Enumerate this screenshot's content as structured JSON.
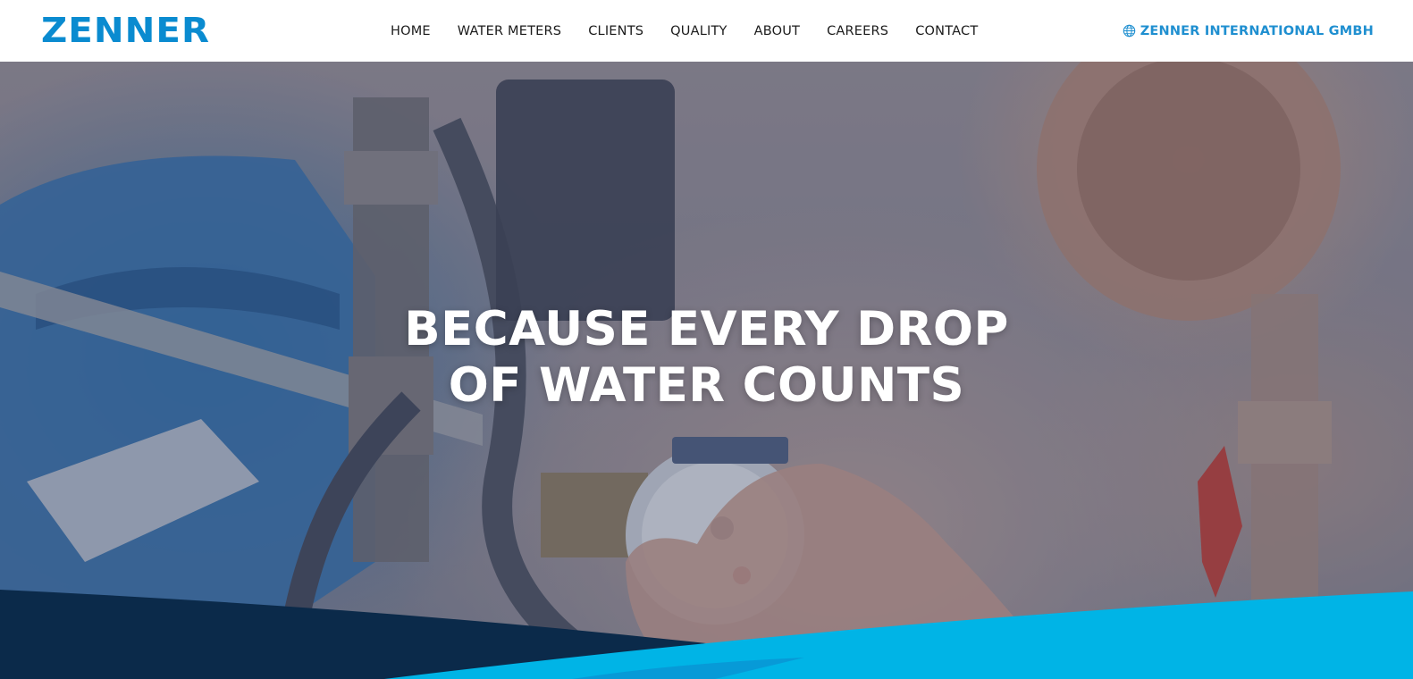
{
  "header": {
    "logo": "ZENNER",
    "nav": [
      {
        "label": "HOME"
      },
      {
        "label": "WATER METERS"
      },
      {
        "label": "CLIENTS"
      },
      {
        "label": "QUALITY"
      },
      {
        "label": "ABOUT"
      },
      {
        "label": "CAREERS"
      },
      {
        "label": "CONTACT"
      }
    ],
    "company_link": {
      "label": "ZENNER INTERNATIONAL GMBH",
      "icon": "globe-icon"
    }
  },
  "hero": {
    "title_line1": "BECAUSE EVERY DROP",
    "title_line2": "OF WATER COUNTS"
  },
  "colors": {
    "brand_blue": "#0a8bd0",
    "link_blue": "#1f8fd0",
    "navy": "#0b2a4a",
    "cyan": "#00b4e6"
  }
}
